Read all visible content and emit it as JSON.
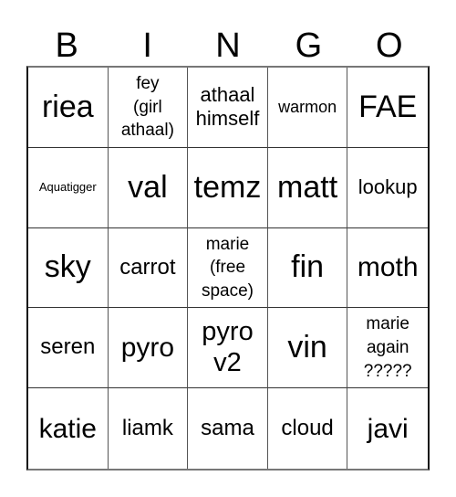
{
  "card": {
    "header": [
      "B",
      "I",
      "N",
      "G",
      "O"
    ],
    "rows": [
      [
        "riea",
        "fey\n(girl\nathaal)",
        "athaal\nhimself",
        "warmon",
        "FAE"
      ],
      [
        "Aquatigger",
        "val",
        "temz",
        "matt",
        "lookup"
      ],
      [
        "sky",
        "carrot",
        "marie\n(free\nspace)",
        "fin",
        "moth"
      ],
      [
        "seren",
        "pyro",
        "pyro\nv2",
        "vin",
        "marie\nagain\n?????"
      ],
      [
        "katie",
        "liamk",
        "sama",
        "cloud",
        "javi"
      ]
    ]
  }
}
